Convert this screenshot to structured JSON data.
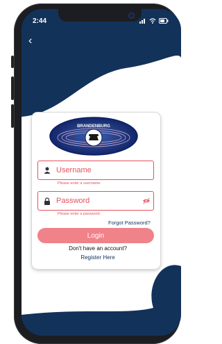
{
  "status_bar": {
    "time": "2:44"
  },
  "nav": {
    "back_label": "‹"
  },
  "logo": {
    "brand_text": "BRANDENBURG"
  },
  "username": {
    "value": "Username",
    "error": "Please enter a username."
  },
  "password": {
    "value": "Password",
    "error": "Please enter a password."
  },
  "forgot_password": "Forgot Password?",
  "login_button": "Login",
  "no_account_text": "Don't have an account?",
  "register_link": "Register Here",
  "colors": {
    "background": "#13325a",
    "accent_error": "#e5525d",
    "login_button": "#f08289",
    "card": "#ffffff"
  },
  "icons": {
    "username": "person-icon",
    "password": "lock-icon",
    "password_toggle": "eye-off-icon",
    "back": "chevron-left-icon"
  }
}
